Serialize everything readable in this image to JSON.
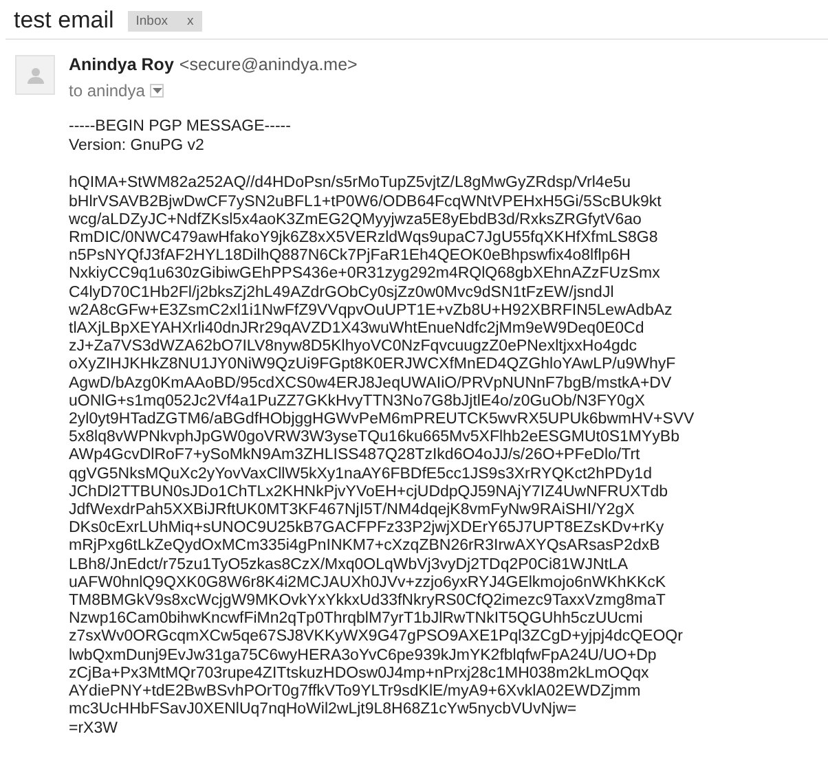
{
  "subject": "test email",
  "labels": [
    {
      "text": "Inbox",
      "close": "x"
    }
  ],
  "sender": {
    "name": "Anindya Roy",
    "email": "<secure@anindya.me>"
  },
  "recipient": "to anindya",
  "body": {
    "header": [
      "-----BEGIN PGP MESSAGE-----",
      "Version: GnuPG v2"
    ],
    "lines": [
      "hQIMA+StWM82a252AQ//d4HDoPsn/s5rMoTupZ5vjtZ/L8gMwGyZRdsp/Vrl4e5u",
      "bHlrVSAVB2BjwDwCF7ySN2uBFL1+tP0W6/ODB64FcqWNtVPEHxH5Gi/5ScBUk9kt",
      "wcg/aLDZyJC+NdfZKsl5x4aoK3ZmEG2QMyyjwza5E8yEbdB3d/RxksZRGfytV6ao",
      "RmDIC/0NWC479awHfakoY9jk6Z8xX5VERzldWqs9upaC7JgU55fqXKHfXfmLS8G8",
      "n5PsNYQfJ3fAF2HYL18DilhQ887N6Ck7PjFaR1Eh4QEOK0eBhpswfix4o8lflp6H",
      "NxkiyCC9q1u630zGibiwGEhPPS436e+0R31zyg292m4RQlQ68gbXEhnAZzFUzSmx",
      "C4lyD70C1Hb2Fl/j2bksZj2hL49AZdrGObCy0sjZz0w0Mvc9dSN1tFzEW/jsndJl",
      "w2A8cGFw+E3ZsmC2xl1i1NwFfZ9VVqpvOuUPT1E+vZb8U+H92XBRFIN5LewAdbAz",
      "tlAXjLBpXEYAHXrli40dnJRr29qAVZD1X43wuWhtEnueNdfc2jMm9eW9Deq0E0Cd",
      "zJ+Za7VS3dWZA62bO7ILV8nyw8D5KlhyoVC0NzFqvcuugzZ0ePNexltjxxHo4gdc",
      "oXyZIHJKHkZ8NU1JY0NiW9QzUi9FGpt8K0ERJWCXfMnED4QZGhloYAwLP/u9WhyF",
      "AgwD/bAzg0KmAAoBD/95cdXCS0w4ERJ8JeqUWAIiO/PRVpNUNnF7bgB/mstkA+DV",
      "uONlG+s1mq052Jc2Vf4a1PuZZ7GKkHvyTTN3No7G8bJjtlE4o/z0GuOb/N3FY0gX",
      "2yl0yt9HTadZGTM6/aBGdfHObjggHGWvPeM6mPREUTCK5wvRX5UPUk6bwmHV+SVV",
      "5x8lq8vWPNkvphJpGW0goVRW3W3yseTQu16ku665Mv5XFlhb2eESGMUt0S1MYyBb",
      "AWp4GcvDlRoF7+ySoMkN9Am3ZHLISS487Q28TzIkd6O4oJJ/s/26O+PFeDlo/Trt",
      "qgVG5NksMQuXc2yYovVaxCllW5kXy1naAY6FBDfE5cc1JS9s3XrRYQKct2hPDy1d",
      "JChDl2TTBUN0sJDo1ChTLx2KHNkPjvYVoEH+cjUDdpQJ59NAjY7IZ4UwNFRUXTdb",
      "JdfWexdrPah5XXBiJRftUK0MT3KF467NjI5T/NM4dqejK8vmFyNw9RAiSHI/Y2gX",
      "DKs0cExrLUhMiq+sUNOC9U25kB7GACFPFz33P2jwjXDErY65J7UPT8EZsKDv+rKy",
      "mRjPxg6tLkZeQydOxMCm335i4gPnINKM7+cXzqZBN26rR3IrwAXYQsARsasP2dxB",
      "LBh8/JnEdct/r75zu1TyO5zkas8CzX/Mxq0OLqWbVj3vyDj2TDq2P0Ci81WJNtLA",
      "uAFW0hnlQ9QXK0G8W6r8K4i2MCJAUXh0JVv+zzjo6yxRYJ4GElkmojo6nWKhKKcK",
      "TM8BMGkV9s8xcWcjgW9MKOvkYxYkkxUd33fNkryRS0CfQ2imezc9TaxxVzmg8maT",
      "Nzwp16Cam0bihwKncwfFiMn2qTp0ThrqblM7yrT1bJlRwTNkIT5QGUhh5czUUcmi",
      "z7sxWv0ORGcqmXCw5qe67SJ8VKKyWX9G47gPSO9AXE1Pql3ZCgD+yjpj4dcQEOQr",
      "lwbQxmDunj9EvJw31ga75C6wyHERA3oYvC6pe939kJmYK2fblqfwFpA24U/UO+Dp",
      "zCjBa+Px3MtMQr703rupe4ZITtskuzHDOsw0J4mp+nPrxj28c1MH038m2kLmOQqx",
      "AYdiePNY+tdE2BwBSvhPOrT0g7ffkVTo9YLTr9sdKlE/myA9+6XvklA02EWDZjmm",
      "mc3UcHHbFSavJ0XENlUq7nqHoWil2wLjt9L8H68Z1cYw5nycbVUvNjw=",
      "=rX3W"
    ]
  }
}
